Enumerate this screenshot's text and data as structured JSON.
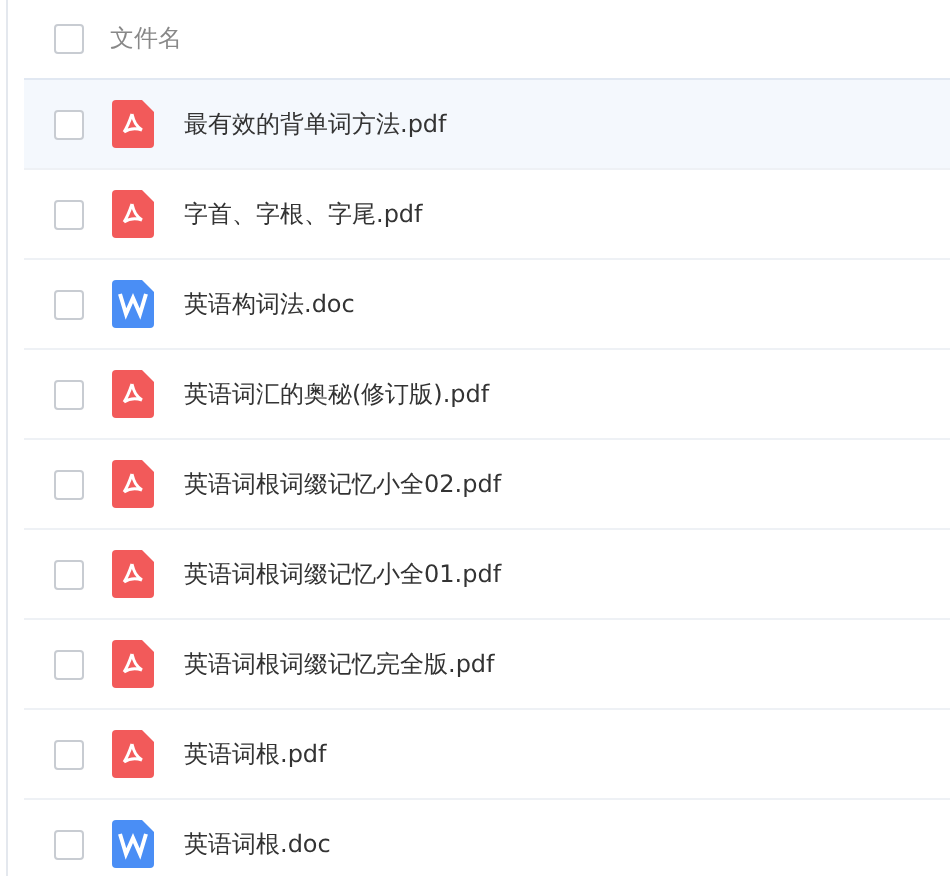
{
  "header": {
    "checked": false,
    "label": "文件名"
  },
  "files": [
    {
      "name": "最有效的背单词方法.pdf",
      "kind": "pdf",
      "checked": false,
      "selected": true
    },
    {
      "name": "字首、字根、字尾.pdf",
      "kind": "pdf",
      "checked": false,
      "selected": false
    },
    {
      "name": "英语构词法.doc",
      "kind": "doc",
      "checked": false,
      "selected": false
    },
    {
      "name": "英语词汇的奥秘(修订版).pdf",
      "kind": "pdf",
      "checked": false,
      "selected": false
    },
    {
      "name": "英语词根词缀记忆小全02.pdf",
      "kind": "pdf",
      "checked": false,
      "selected": false
    },
    {
      "name": "英语词根词缀记忆小全01.pdf",
      "kind": "pdf",
      "checked": false,
      "selected": false
    },
    {
      "name": "英语词根词缀记忆完全版.pdf",
      "kind": "pdf",
      "checked": false,
      "selected": false
    },
    {
      "name": "英语词根.pdf",
      "kind": "pdf",
      "checked": false,
      "selected": false
    },
    {
      "name": "英语词根.doc",
      "kind": "doc",
      "checked": false,
      "selected": false
    }
  ]
}
